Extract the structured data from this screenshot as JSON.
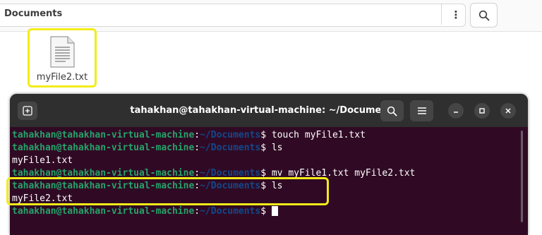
{
  "file_manager": {
    "location": "Documents",
    "menu_glyph": "⋮",
    "files": [
      {
        "name": "myFile2.txt",
        "icon": "text-document-icon"
      }
    ]
  },
  "terminal": {
    "title": "tahakhan@tahakhan-virtual-machine: ~/Documents",
    "user": "tahakhan@tahakhan-virtual-machine",
    "colon": ":",
    "path": "~/Documents",
    "dollar": "$ ",
    "lines": [
      {
        "type": "prompt",
        "command": "touch myFile1.txt"
      },
      {
        "type": "prompt",
        "command": "ls"
      },
      {
        "type": "output",
        "text": "myFile1.txt"
      },
      {
        "type": "prompt",
        "command": "mv myFile1.txt myFile2.txt"
      },
      {
        "type": "prompt",
        "command": "ls"
      },
      {
        "type": "output",
        "text": "myFile2.txt"
      },
      {
        "type": "prompt",
        "command": ""
      }
    ],
    "colors": {
      "background": "#300a24",
      "user": "#26a269",
      "path": "#12488b"
    }
  },
  "highlight_color": "#f2ec1a"
}
